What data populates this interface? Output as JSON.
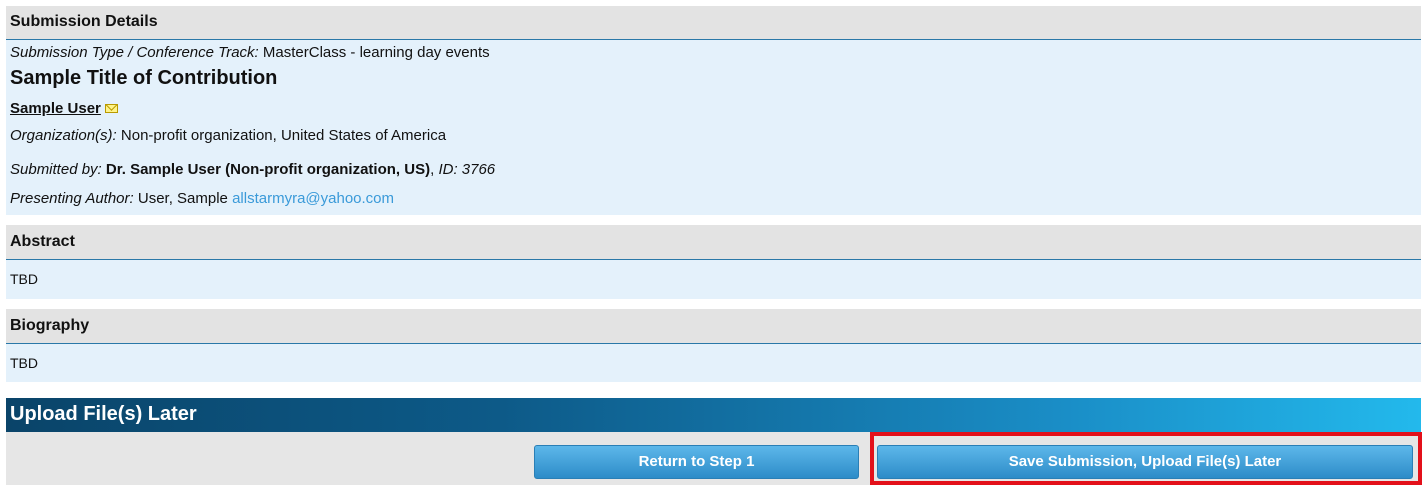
{
  "details": {
    "header": "Submission Details",
    "type_label": "Submission Type / Conference Track:",
    "type_value": "MasterClass - learning day events",
    "title": "Sample Title of Contribution",
    "author_name": "Sample User",
    "org_label": "Organization(s):",
    "org_value": "Non-profit organization, United States of America",
    "submitted_label": "Submitted by:",
    "submitted_value": "Dr. Sample User (Non-profit organization, US)",
    "id_label": "ID: 3766",
    "presenting_label": "Presenting Author:",
    "presenting_value": "User, Sample",
    "presenting_email": "allstarmyra@yahoo.com"
  },
  "abstract": {
    "header": "Abstract",
    "body": "TBD"
  },
  "biography": {
    "header": "Biography",
    "body": "TBD"
  },
  "upload": {
    "header": "Upload File(s) Later",
    "return_label": "Return to Step 1",
    "save_label": "Save Submission, Upload File(s) Later"
  },
  "colors": {
    "highlight": "#e3101a",
    "section_body": "#e4f1fb",
    "section_head": "#e3e3e3",
    "link": "#3a9ad9"
  }
}
